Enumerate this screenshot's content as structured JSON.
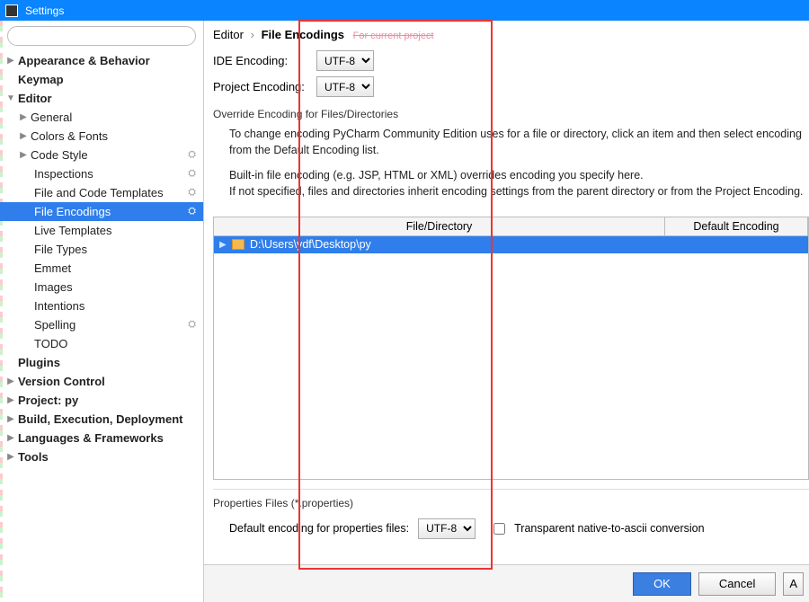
{
  "title": "Settings",
  "search": {
    "placeholder": ""
  },
  "sidebar": {
    "appearance": "Appearance & Behavior",
    "keymap": "Keymap",
    "editor": "Editor",
    "general": "General",
    "colors": "Colors & Fonts",
    "codestyle": "Code Style",
    "inspections": "Inspections",
    "filecode": "File and Code Templates",
    "fileenc": "File Encodings",
    "livetpl": "Live Templates",
    "filetypes": "File Types",
    "emmet": "Emmet",
    "images": "Images",
    "intentions": "Intentions",
    "spelling": "Spelling",
    "todo": "TODO",
    "plugins": "Plugins",
    "vcs": "Version Control",
    "project": "Project: py",
    "build": "Build, Execution, Deployment",
    "lang": "Languages & Frameworks",
    "tools": "Tools"
  },
  "crumb": {
    "root": "Editor",
    "current": "File Encodings",
    "proj": "For current project"
  },
  "enc": {
    "ide_label": "IDE Encoding:",
    "ide_value": "UTF-8",
    "proj_label": "Project Encoding:",
    "proj_value": "UTF-8"
  },
  "override_heading": "Override Encoding for Files/Directories",
  "desc": {
    "p1": "To change encoding PyCharm Community Edition uses for a file or directory, click an item and then select encoding from the Default Encoding list.",
    "p2": "Built-in file encoding (e.g. JSP, HTML or XML) overrides encoding you specify here.",
    "p3": "If not specified, files and directories inherit encoding settings from the parent directory or from the Project Encoding."
  },
  "table": {
    "col1": "File/Directory",
    "col2": "Default Encoding",
    "row_path": "D:\\Users\\ydf\\Desktop\\py"
  },
  "props": {
    "heading": "Properties Files (*.properties)",
    "label": "Default encoding for properties files:",
    "value": "UTF-8",
    "checkbox_label": "Transparent native-to-ascii conversion"
  },
  "buttons": {
    "ok": "OK",
    "cancel": "Cancel",
    "apply_initial": "A"
  }
}
